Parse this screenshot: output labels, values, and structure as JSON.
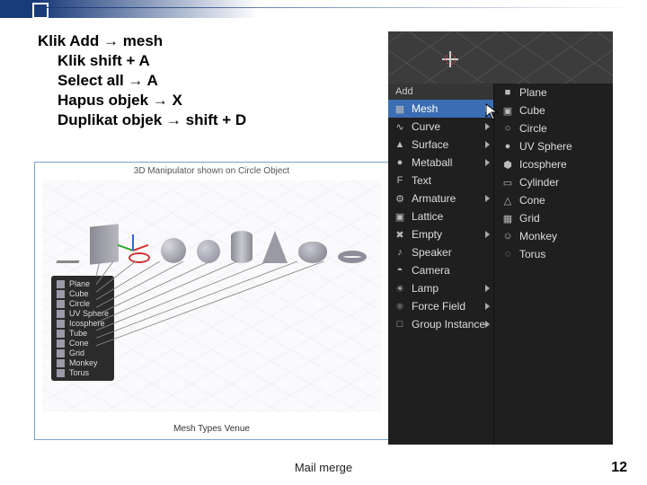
{
  "instructions": {
    "line1": "Klik Add → mesh",
    "line2": "Klik shift + A",
    "line3": "Select all → A",
    "line4": "Hapus objek → X",
    "line5": "Duplikat objek → shift + D"
  },
  "left_figure": {
    "title": "3D Manipulator shown on Circle Object",
    "caption": "Mesh Types Venue",
    "shape_labels": [
      "Plane",
      "Cube",
      "Circle",
      "UV Sphere",
      "Icosphere",
      "Tube",
      "Cone",
      "Grid",
      "Monkey",
      "Torus"
    ]
  },
  "right_panel": {
    "add_header": "Add",
    "left_menu": [
      {
        "icon": "▦",
        "cls": "ic-mesh",
        "label": "Mesh",
        "highlight": true,
        "submenu": true
      },
      {
        "icon": "∿",
        "cls": "ic-curve",
        "label": "Curve",
        "submenu": true
      },
      {
        "icon": "▲",
        "cls": "ic-surface",
        "label": "Surface",
        "submenu": true
      },
      {
        "icon": "●",
        "cls": "ic-metaball",
        "label": "Metaball",
        "submenu": true
      },
      {
        "icon": "F",
        "cls": "ic-text",
        "label": "Text"
      },
      {
        "icon": "⚙",
        "cls": "ic-armature",
        "label": "Armature",
        "submenu": true
      },
      {
        "icon": "▣",
        "cls": "ic-lattice",
        "label": "Lattice"
      },
      {
        "icon": "✖",
        "cls": "ic-empty",
        "label": "Empty",
        "submenu": true
      },
      {
        "icon": "♪",
        "cls": "ic-speaker",
        "label": "Speaker"
      },
      {
        "icon": "◓",
        "cls": "ic-camera",
        "label": "Camera"
      },
      {
        "icon": "☀",
        "cls": "ic-lamp",
        "label": "Lamp",
        "submenu": true
      },
      {
        "icon": "⚛",
        "cls": "ic-force",
        "label": "Force Field",
        "submenu": true
      },
      {
        "icon": "□",
        "cls": "ic-group",
        "label": "Group Instance",
        "submenu": true
      }
    ],
    "right_menu": [
      {
        "icon": "■",
        "label": "Plane"
      },
      {
        "icon": "▣",
        "label": "Cube"
      },
      {
        "icon": "○",
        "label": "Circle"
      },
      {
        "icon": "●",
        "label": "UV Sphere"
      },
      {
        "icon": "⬢",
        "label": "Icosphere"
      },
      {
        "icon": "▭",
        "label": "Cylinder"
      },
      {
        "icon": "△",
        "label": "Cone"
      },
      {
        "icon": "▦",
        "label": "Grid"
      },
      {
        "icon": "☺",
        "label": "Monkey"
      },
      {
        "icon": "◌",
        "label": "Torus"
      }
    ]
  },
  "footer": "Mail merge",
  "page_number": "12"
}
